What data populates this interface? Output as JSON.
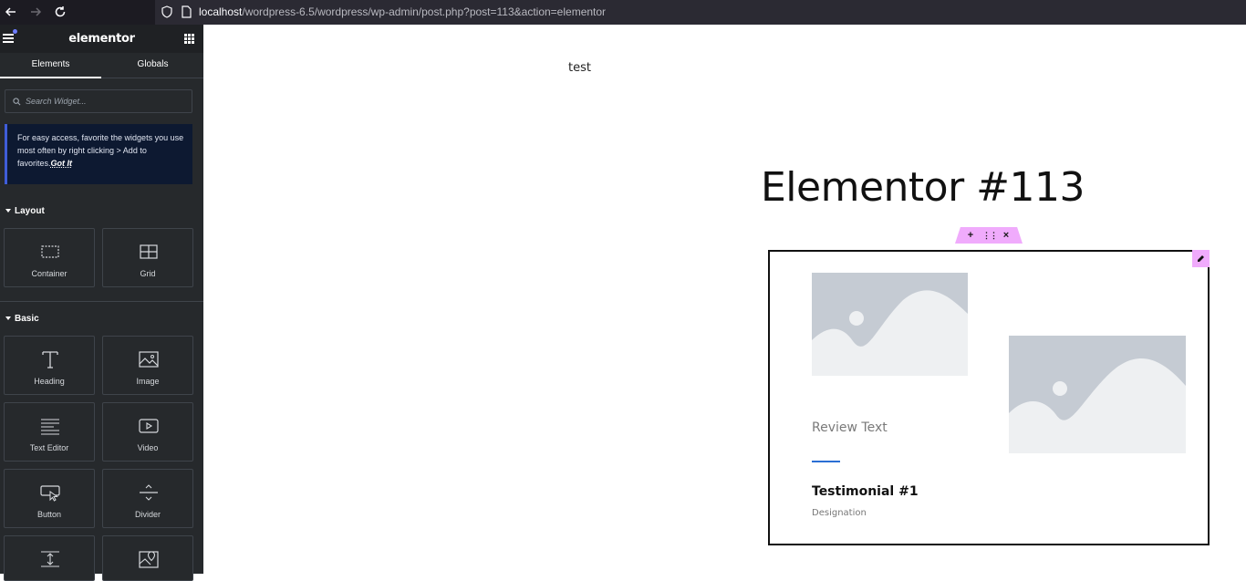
{
  "browser": {
    "url_host": "localhost",
    "url_path": "/wordpress-6.5/wordpress/wp-admin/post.php?post=113&action=elementor"
  },
  "panel": {
    "logo": "elementor",
    "tabs": [
      "Elements",
      "Globals"
    ],
    "search_placeholder": "Search Widget...",
    "tip_text": "For easy access, favorite the widgets you use most often by right clicking > Add to favorites.",
    "tip_link": "Got It",
    "sections": [
      {
        "title": "Layout",
        "widgets": [
          {
            "label": "Container",
            "icon": "container-icon"
          },
          {
            "label": "Grid",
            "icon": "grid-icon"
          }
        ]
      },
      {
        "title": "Basic",
        "widgets": [
          {
            "label": "Heading",
            "icon": "heading-icon"
          },
          {
            "label": "Image",
            "icon": "image-icon"
          },
          {
            "label": "Text Editor",
            "icon": "text-editor-icon"
          },
          {
            "label": "Video",
            "icon": "video-icon"
          },
          {
            "label": "Button",
            "icon": "button-icon"
          },
          {
            "label": "Divider",
            "icon": "divider-icon"
          }
        ]
      }
    ]
  },
  "canvas": {
    "test_text": "test",
    "page_title": "Elementor #113",
    "testimonial": {
      "review": "Review Text",
      "name": "Testimonial #1",
      "designation": "Designation"
    },
    "handle": {
      "add": "+",
      "move": "⋮⋮",
      "close": "×"
    }
  },
  "colors": {
    "panel_bg": "#26292c",
    "handle_pink": "#f0abfc",
    "accent_blue": "#2a6ed4"
  }
}
